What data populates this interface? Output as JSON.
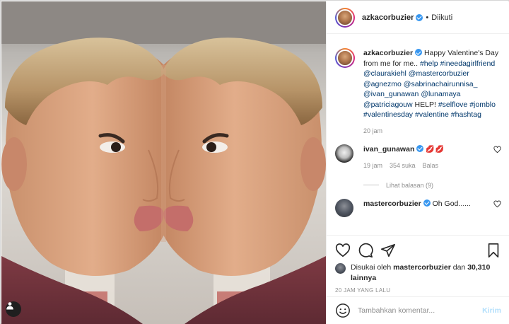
{
  "post": {
    "username": "azkacorbuzier",
    "follow_dot": "•",
    "follow_status": "Diikuti"
  },
  "caption": {
    "username": "azkacorbuzier",
    "text_plain_1": "Happy Valentine's Day from me for me..",
    "tags": [
      "#help",
      "#ineedagirlfriend",
      "@claurakiehl",
      "@mastercorbuzier",
      "@agnezmo",
      "@sabrinachairunnisa_",
      "@ivan_gunawan",
      "@lunamaya",
      "@patriciagouw"
    ],
    "text_plain_2": "HELP!",
    "tags2": [
      "#selflove",
      "#jomblo",
      "#valentinesday",
      "#valentine",
      "#hashtag"
    ],
    "time": "20 jam"
  },
  "comments": [
    {
      "username": "ivan_gunawan",
      "text": "💋💋",
      "time": "19 jam",
      "likes": "354 suka",
      "reply_label": "Balas",
      "view_replies": "Lihat balasan (9)"
    },
    {
      "username": "mastercorbuzier",
      "text": "Oh God......"
    }
  ],
  "likes": {
    "prefix": "Disukai oleh",
    "user": "mastercorbuzier",
    "and": "dan",
    "count": "30,310 lainnya"
  },
  "date": "20 JAM YANG LALU",
  "add_comment": {
    "placeholder": "Tambahkan komentar...",
    "post_label": "Kirim"
  },
  "colors": {
    "verified": "#3897f0",
    "link": "#00376b",
    "muted": "#8e8e8e",
    "post_button_disabled": "#b2dffc"
  }
}
